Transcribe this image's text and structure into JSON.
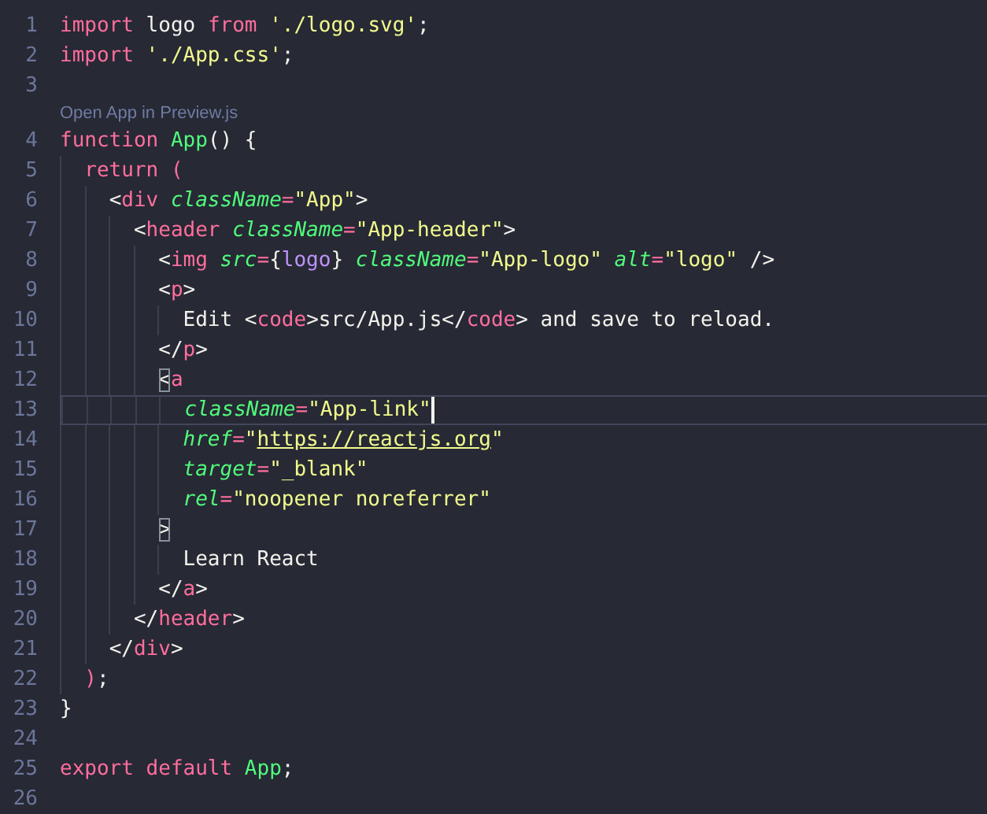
{
  "editor": {
    "lines": [
      {
        "number": "1",
        "current": false,
        "tokens": [
          {
            "text": "import",
            "kind": "keyword"
          },
          {
            "text": " logo ",
            "kind": "plain"
          },
          {
            "text": "from",
            "kind": "keyword"
          },
          {
            "text": " './logo.svg'",
            "kind": "string"
          },
          {
            "text": ";",
            "kind": "plain"
          }
        ]
      },
      {
        "number": "2",
        "current": false,
        "tokens": [
          {
            "text": "import",
            "kind": "keyword"
          },
          {
            "text": " './App.css'",
            "kind": "string"
          },
          {
            "text": ";",
            "kind": "plain"
          }
        ]
      },
      {
        "number": "3",
        "current": false
      },
      {
        "kind": "codelens",
        "text": "Open App in Preview.js"
      },
      {
        "number": "4",
        "current": false,
        "tokens": [
          {
            "text": "function",
            "kind": "keyword"
          },
          {
            "text": " App",
            "kind": "function"
          },
          {
            "text": "() {",
            "kind": "plain"
          }
        ]
      },
      {
        "number": "5",
        "current": false,
        "tokens": [
          {
            "text": "  return (",
            "kind": "keyword"
          }
        ]
      },
      {
        "number": "6",
        "current": false,
        "tokens": [
          {
            "text": "    <",
            "kind": "plain"
          },
          {
            "text": "div",
            "kind": "tag"
          },
          {
            "text": " className",
            "kind": "attribute"
          },
          {
            "text": "=",
            "kind": "operator"
          },
          {
            "text": "\"App\"",
            "kind": "string"
          },
          {
            "text": ">",
            "kind": "plain"
          }
        ]
      },
      {
        "number": "7",
        "current": false,
        "tokens": [
          {
            "text": "      <",
            "kind": "plain"
          },
          {
            "text": "header",
            "kind": "tag"
          },
          {
            "text": " className",
            "kind": "attribute"
          },
          {
            "text": "=",
            "kind": "operator"
          },
          {
            "text": "\"App-header\"",
            "kind": "string"
          },
          {
            "text": ">",
            "kind": "plain"
          }
        ]
      },
      {
        "number": "8",
        "current": false,
        "tokens": [
          {
            "text": "        <",
            "kind": "plain"
          },
          {
            "text": "img",
            "kind": "tag"
          },
          {
            "text": " src",
            "kind": "attribute"
          },
          {
            "text": "=",
            "kind": "operator"
          },
          {
            "text": "{",
            "kind": "plain"
          },
          {
            "text": "logo",
            "kind": "variable"
          },
          {
            "text": "}",
            "kind": "plain"
          },
          {
            "text": " className",
            "kind": "attribute"
          },
          {
            "text": "=",
            "kind": "operator"
          },
          {
            "text": "\"App-logo\"",
            "kind": "string"
          },
          {
            "text": " alt",
            "kind": "attribute"
          },
          {
            "text": "=",
            "kind": "operator"
          },
          {
            "text": "\"logo\"",
            "kind": "string"
          },
          {
            "text": " />",
            "kind": "plain"
          }
        ]
      },
      {
        "number": "9",
        "current": false,
        "tokens": [
          {
            "text": "        <",
            "kind": "plain"
          },
          {
            "text": "p",
            "kind": "tag"
          },
          {
            "text": ">",
            "kind": "plain"
          }
        ]
      },
      {
        "number": "10",
        "current": false,
        "tokens": [
          {
            "text": "          Edit <",
            "kind": "plain"
          },
          {
            "text": "code",
            "kind": "tag"
          },
          {
            "text": ">src/App.js</",
            "kind": "plain"
          },
          {
            "text": "code",
            "kind": "tag"
          },
          {
            "text": "> and save to reload.",
            "kind": "plain"
          }
        ]
      },
      {
        "number": "11",
        "current": false,
        "tokens": [
          {
            "text": "        </",
            "kind": "plain"
          },
          {
            "text": "p",
            "kind": "tag"
          },
          {
            "text": ">",
            "kind": "plain"
          }
        ]
      },
      {
        "number": "12",
        "current": false,
        "tokens": [
          {
            "text": "        <",
            "kind": "plain",
            "matched": true
          },
          {
            "text": "a",
            "kind": "tag"
          }
        ]
      },
      {
        "number": "13",
        "current": true,
        "tokens": [
          {
            "text": "          className",
            "kind": "attribute"
          },
          {
            "text": "=",
            "kind": "operator"
          },
          {
            "text": "\"App-link\"",
            "kind": "string",
            "caret": true
          }
        ]
      },
      {
        "number": "14",
        "current": false,
        "tokens": [
          {
            "text": "          href",
            "kind": "attribute"
          },
          {
            "text": "=",
            "kind": "operator"
          },
          {
            "text": "\"",
            "kind": "string"
          },
          {
            "text": "https://reactjs.org",
            "kind": "link"
          },
          {
            "text": "\"",
            "kind": "string"
          }
        ]
      },
      {
        "number": "15",
        "current": false,
        "tokens": [
          {
            "text": "          target",
            "kind": "attribute"
          },
          {
            "text": "=",
            "kind": "operator"
          },
          {
            "text": "\"_blank\"",
            "kind": "string"
          }
        ]
      },
      {
        "number": "16",
        "current": false,
        "tokens": [
          {
            "text": "          rel",
            "kind": "attribute"
          },
          {
            "text": "=",
            "kind": "operator"
          },
          {
            "text": "\"noopener noreferrer\"",
            "kind": "string"
          }
        ]
      },
      {
        "number": "17",
        "current": false,
        "tokens": [
          {
            "text": "        >",
            "kind": "plain",
            "matched": true
          }
        ]
      },
      {
        "number": "18",
        "current": false,
        "tokens": [
          {
            "text": "          Learn React",
            "kind": "plain"
          }
        ]
      },
      {
        "number": "19",
        "current": false,
        "tokens": [
          {
            "text": "        </",
            "kind": "plain"
          },
          {
            "text": "a",
            "kind": "tag"
          },
          {
            "text": ">",
            "kind": "plain"
          }
        ]
      },
      {
        "number": "20",
        "current": false,
        "tokens": [
          {
            "text": "      </",
            "kind": "plain"
          },
          {
            "text": "header",
            "kind": "tag"
          },
          {
            "text": ">",
            "kind": "plain"
          }
        ]
      },
      {
        "number": "21",
        "current": false,
        "tokens": [
          {
            "text": "    </",
            "kind": "plain"
          },
          {
            "text": "div",
            "kind": "tag"
          },
          {
            "text": ">",
            "kind": "plain"
          }
        ]
      },
      {
        "number": "22",
        "current": false,
        "tokens": [
          {
            "text": "  )",
            "kind": "operator"
          },
          {
            "text": ";",
            "kind": "plain"
          }
        ]
      },
      {
        "number": "23",
        "current": false,
        "tokens": [
          {
            "text": "}",
            "kind": "plain"
          }
        ]
      },
      {
        "number": "24",
        "current": false
      },
      {
        "number": "25",
        "current": false,
        "tokens": [
          {
            "text": "export",
            "kind": "keyword"
          },
          {
            "text": " default",
            "kind": "keyword"
          },
          {
            "text": " App",
            "kind": "function"
          },
          {
            "text": ";",
            "kind": "plain"
          }
        ]
      },
      {
        "number": "26",
        "current": false
      }
    ]
  }
}
